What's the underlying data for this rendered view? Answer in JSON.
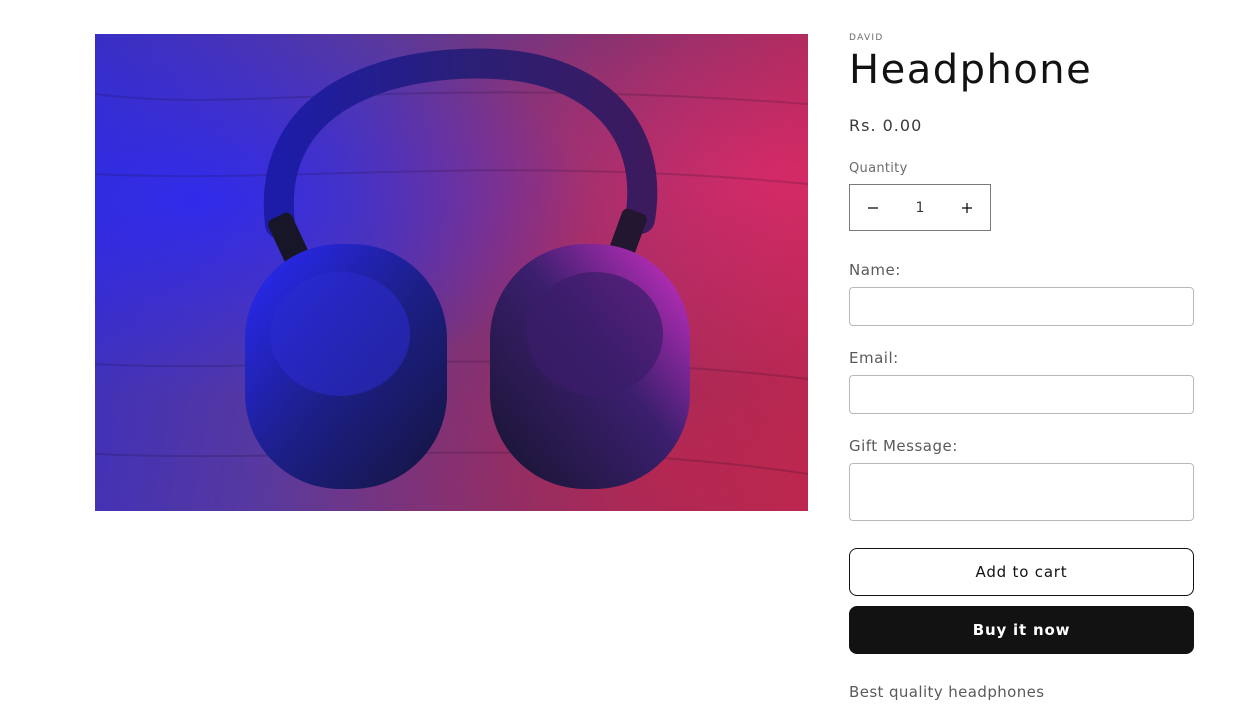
{
  "product": {
    "vendor": "DAVID",
    "title": "Headphone",
    "price": "Rs. 0.00",
    "image_subject": "headphone-photo",
    "description": "Best quality headphones"
  },
  "quantity": {
    "label": "Quantity",
    "value": "1",
    "decrease_icon": "minus-icon",
    "increase_icon": "plus-icon"
  },
  "form": {
    "name_label": "Name:",
    "name_value": "",
    "email_label": "Email:",
    "email_value": "",
    "gift_label": "Gift Message:",
    "gift_value": ""
  },
  "actions": {
    "add_to_cart": "Add to cart",
    "buy_now": "Buy it now"
  },
  "colors": {
    "text": "#121212",
    "button_dark": "#121212",
    "border": "#b8b8b8"
  }
}
